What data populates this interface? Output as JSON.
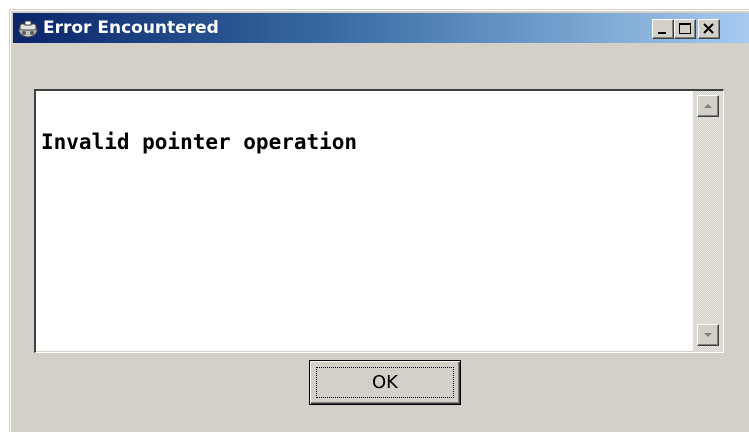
{
  "window": {
    "title": "Error Encountered",
    "icon": "error-dialog-icon",
    "controls": {
      "minimize": "minimize-icon",
      "maximize": "maximize-icon",
      "close": "close-icon"
    }
  },
  "message": {
    "text": "Invalid pointer operation"
  },
  "scrollbar": {
    "up_icon": "arrow-up-icon",
    "down_icon": "arrow-down-icon"
  },
  "actions": {
    "ok_label": "OK"
  },
  "colors": {
    "titlebar_start": "#0a246a",
    "titlebar_end": "#a6caf0",
    "face": "#d4d0c8"
  }
}
